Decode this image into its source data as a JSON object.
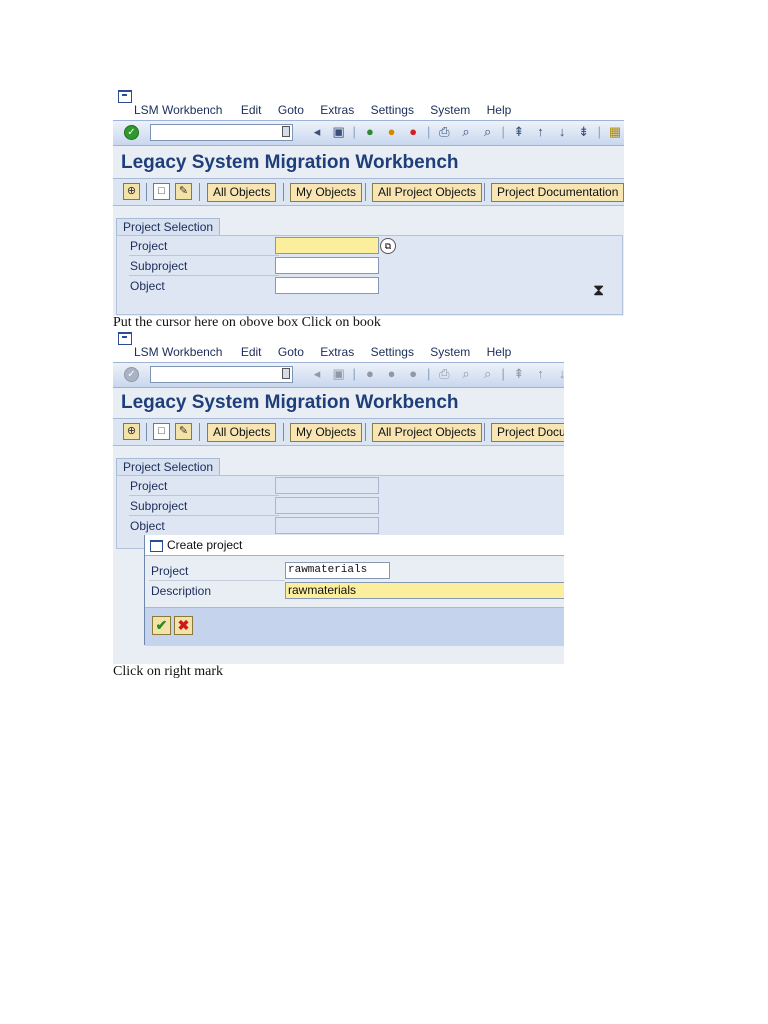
{
  "menu": [
    "LSM Workbench",
    "Edit",
    "Goto",
    "Extras",
    "Settings",
    "System",
    "Help"
  ],
  "window_title": "Legacy System Migration Workbench",
  "app_buttons": [
    "All Objects",
    "My Objects",
    "All Project Objects",
    "Project Documentation"
  ],
  "app_buttons_clipped": {
    "last": "Project Docu"
  },
  "selection": {
    "frame_title": "Project Selection",
    "labels": [
      "Project",
      "Subproject",
      "Object"
    ]
  },
  "captions": {
    "first": "Put the cursor here on obove box Click on book",
    "second": "Click on right mark"
  },
  "popup": {
    "title": "Create project",
    "project_label": "Project",
    "project_value": "rawmaterials",
    "description_label": "Description",
    "description_value": "rawmaterials",
    "confirm_icon": "checkmark-icon",
    "cancel_icon": "cancel-x-icon"
  },
  "colors": {
    "title_blue": "#1f3f7a",
    "required_yellow": "#fbee9d",
    "button_yellow": "#f7e6b3"
  }
}
